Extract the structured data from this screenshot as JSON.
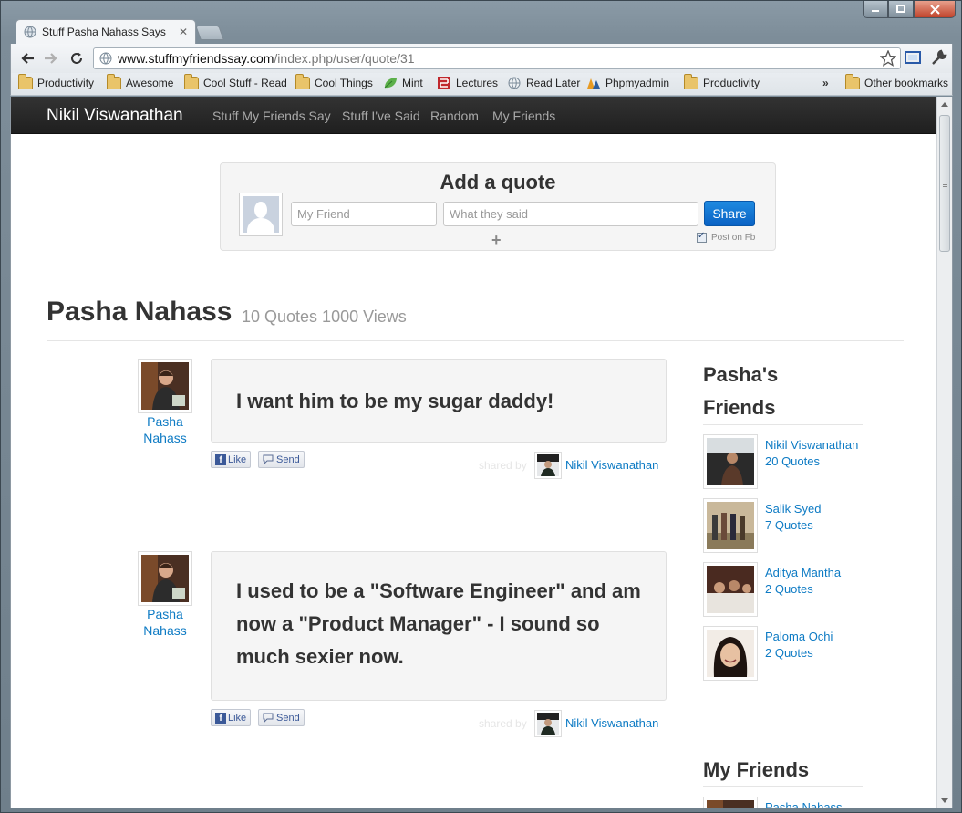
{
  "browser": {
    "tab_title": "Stuff Pasha Nahass Says",
    "url_host": "www.stuffmyfriendssay.com",
    "url_path": "/index.php/user/quote/31",
    "bookmarks": [
      {
        "label": "Productivity",
        "icon": "folder-icon"
      },
      {
        "label": "Awesome",
        "icon": "folder-icon"
      },
      {
        "label": "Cool Stuff - Read",
        "icon": "folder-icon"
      },
      {
        "label": "Cool Things",
        "icon": "folder-icon"
      },
      {
        "label": "Mint",
        "icon": "mint-leaf-icon"
      },
      {
        "label": "Lectures",
        "icon": "lectures-icon"
      },
      {
        "label": "Read Later",
        "icon": "globe-icon"
      },
      {
        "label": "Phpmyadmin",
        "icon": "phpmyadmin-icon"
      },
      {
        "label": "Productivity",
        "icon": "folder-icon"
      }
    ],
    "overflow_label": "»",
    "other_bookmarks": "Other bookmarks"
  },
  "nav": {
    "brand": "Nikil Viswanathan",
    "links": [
      "Stuff My Friends Say",
      "Stuff I've Said",
      "Random",
      "My Friends"
    ]
  },
  "add_quote": {
    "title": "Add a quote",
    "friend_placeholder": "My Friend",
    "quote_placeholder": "What they said",
    "share_label": "Share",
    "plus_label": "+",
    "post_fb_label": "Post on Fb",
    "post_fb_checked": true
  },
  "profile": {
    "name": "Pasha Nahass",
    "stats": "10 Quotes 1000 Views"
  },
  "quotes": [
    {
      "author_line1": "Pasha",
      "author_line2": "Nahass",
      "text": "I want him to be my sugar daddy!",
      "like_label": "Like",
      "send_label": "Send",
      "shared_by_label": "shared by",
      "sharer": "Nikil Viswanathan"
    },
    {
      "author_line1": "Pasha",
      "author_line2": "Nahass",
      "text": "I used to be a \"Software Engineer\" and am now a \"Product Manager\" - I sound so much sexier now.",
      "like_label": "Like",
      "send_label": "Send",
      "shared_by_label": "shared by",
      "sharer": "Nikil Viswanathan"
    }
  ],
  "sidebar": {
    "friends_heading_line1": "Pasha's",
    "friends_heading_line2": "Friends",
    "friends": [
      {
        "name": "Nikil Viswanathan",
        "count": "20 Quotes"
      },
      {
        "name": "Salik Syed",
        "count": "7 Quotes"
      },
      {
        "name": "Aditya Mantha",
        "count": "2 Quotes"
      },
      {
        "name": "Paloma Ochi",
        "count": "2 Quotes"
      }
    ],
    "my_friends_heading": "My Friends",
    "my_friends_partial": "Pasha Nahass"
  },
  "colors": {
    "link": "#0e7bc4",
    "navbar": "#222222",
    "share_button": "#0a62c4"
  }
}
